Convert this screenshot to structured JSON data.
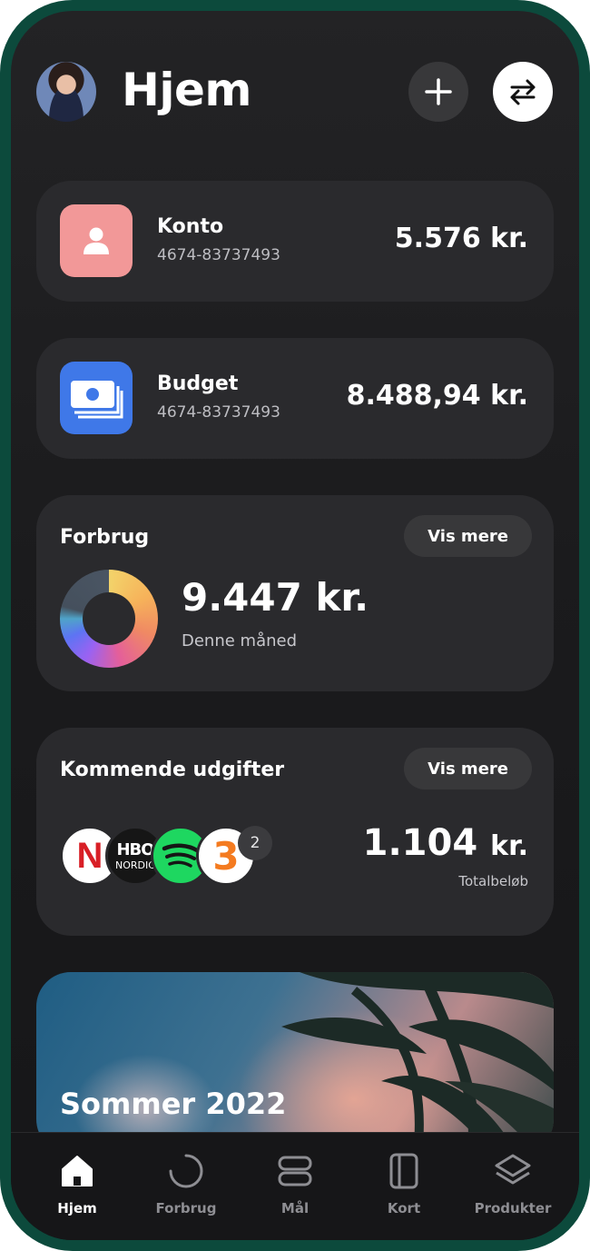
{
  "header": {
    "title": "Hjem"
  },
  "accounts": [
    {
      "name": "Konto",
      "number": "4674-83737493",
      "amount": "5.576 kr.",
      "icon": "user-icon",
      "color": "#f29898"
    },
    {
      "name": "Budget",
      "number": "4674-83737493",
      "amount": "8.488,94 kr.",
      "icon": "money-icon",
      "color": "#3f78e8"
    }
  ],
  "spending": {
    "title": "Forbrug",
    "button": "Vis mere",
    "amount": "9.447 kr.",
    "subtitle": "Denne måned"
  },
  "upcoming": {
    "title": "Kommende udgifter",
    "button": "Vis mere",
    "amount": "1.104",
    "unit": "kr.",
    "subtitle": "Totalbeløb",
    "logos": {
      "netflix": "N",
      "hbo_main": "HBO",
      "hbo_sub": "NORDIC",
      "three": "3"
    },
    "more_count": "2"
  },
  "promo": {
    "title": "Sommer 2022"
  },
  "tabs": [
    {
      "label": "Hjem",
      "icon": "home-icon"
    },
    {
      "label": "Forbrug",
      "icon": "spending-ring-icon"
    },
    {
      "label": "Mål",
      "icon": "goals-icon"
    },
    {
      "label": "Kort",
      "icon": "card-icon"
    },
    {
      "label": "Produkter",
      "icon": "layers-icon"
    }
  ],
  "colors": {
    "accent_konto": "#f29898",
    "accent_budget": "#3f78e8",
    "frame": "#0c4a3c"
  }
}
